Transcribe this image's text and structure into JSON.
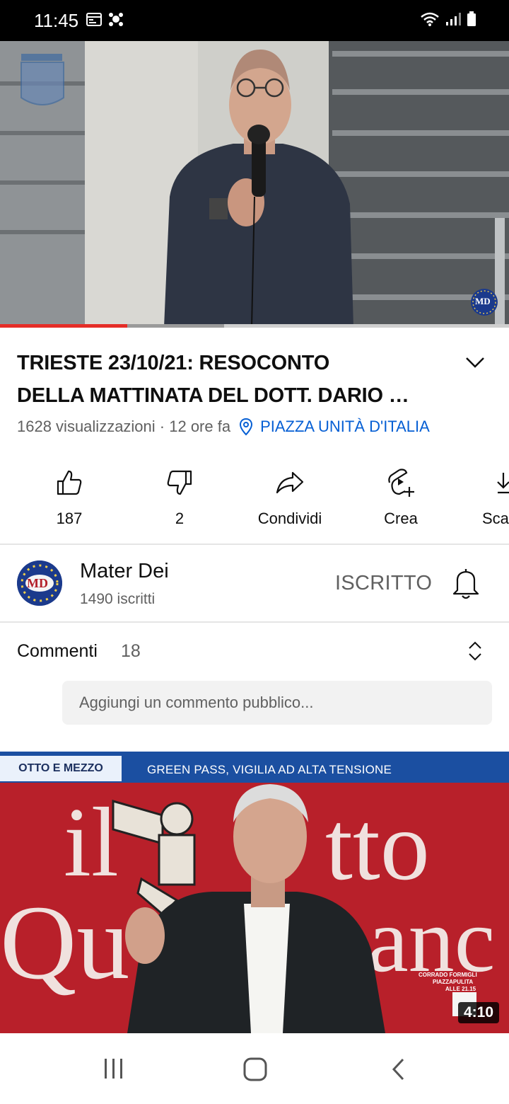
{
  "status_bar": {
    "time": "11:45"
  },
  "player": {
    "progress": 0.25,
    "buffered": 0.44,
    "watermark": "MD"
  },
  "video": {
    "title_line1": "TRIESTE 23/10/21: RESOCONTO",
    "title_line2": "DELLA MATTINATA DEL  DOTT. DARIO …",
    "views": "1628 visualizzazioni",
    "separator": " · ",
    "age": "12 ore fa",
    "location": "PIAZZA UNITÀ D'ITALIA"
  },
  "actions": {
    "like": "187",
    "dislike": "2",
    "share": "Condividi",
    "create": "Crea",
    "download": "Sca"
  },
  "channel": {
    "name": "Mater Dei",
    "subscribers": "1490 iscritti",
    "avatar_text": "MD",
    "subscribe_state": "ISCRITTO"
  },
  "comments": {
    "title": "Commenti",
    "count": "18",
    "placeholder": "Aggiungi un commento pubblico..."
  },
  "next_video": {
    "show_name": "OTTO E MEZZO",
    "banner": "GREEN PASS, VIGILIA AD ALTA TENSIONE",
    "duration": "4:10"
  },
  "colors": {
    "accent": "#e52d27",
    "link": "#065fd4",
    "banner_blue": "#1b4fa1",
    "banner_red": "#b8202a"
  }
}
